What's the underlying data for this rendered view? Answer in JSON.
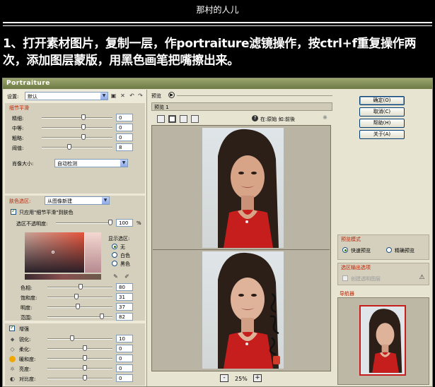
{
  "header": {
    "site_title": "那村的人儿",
    "instruction": "1、打开素材图片，复制一层，作portraiture滤镜操作，按ctrl+f重复操作两次，添加图层蒙版，用黑色画笔把嘴擦出来。"
  },
  "window": {
    "title": "Portraiture"
  },
  "settings": {
    "label": "设置:",
    "value": "默认"
  },
  "detail_smoothing": {
    "title": "细节平滑",
    "rows": [
      {
        "label": "精细:",
        "value": "0"
      },
      {
        "label": "中等:",
        "value": "0"
      },
      {
        "label": "粗略:",
        "value": "0"
      },
      {
        "label": "阈值:",
        "value": "8"
      }
    ],
    "size_label": "肖像大小:",
    "size_value": "自动检测"
  },
  "skin_mask": {
    "title": "肤色选区:",
    "source": "从图像新建",
    "only_label": "只应用\"细节平滑\"到肤色",
    "opacity_label": "选区不透明度:",
    "opacity_value": "100",
    "opacity_unit": "%",
    "display_label": "显示选区:",
    "display_options": [
      "无",
      "白色",
      "黑色"
    ],
    "rows": [
      {
        "label": "色相:",
        "value": "80"
      },
      {
        "label": "饱和度:",
        "value": "31"
      },
      {
        "label": "明度:",
        "value": "37"
      },
      {
        "label": "范围:",
        "value": "82"
      }
    ]
  },
  "enhance": {
    "title": "增强",
    "rows": [
      {
        "label": "锐化:",
        "value": "10"
      },
      {
        "label": "柔化:",
        "value": "0"
      },
      {
        "label": "暖和度:",
        "value": "0"
      },
      {
        "label": "亮度:",
        "value": "0"
      },
      {
        "label": "对比度:",
        "value": "0"
      }
    ]
  },
  "preview": {
    "header": "预览",
    "tab": "预览 1",
    "hint": "在:原始 如:前後",
    "help_glyph": "?",
    "zoom": "25%",
    "zoom_minus": "-",
    "zoom_plus": "+"
  },
  "buttons": {
    "ok": "确定(O)",
    "cancel": "取消(C)",
    "help": "帮助(H)",
    "about": "关于(A)"
  },
  "preview_mode": {
    "title": "预览模式",
    "fast": "快速预览",
    "accurate": "精确预览"
  },
  "output": {
    "title": "选区输出选项",
    "transparent": "创建透明图层"
  },
  "navigator": {
    "title": "导航器"
  },
  "colors": {
    "accent_red": "#c02000",
    "titlebar": "#7d8a52",
    "panel": "#ece9d8"
  }
}
